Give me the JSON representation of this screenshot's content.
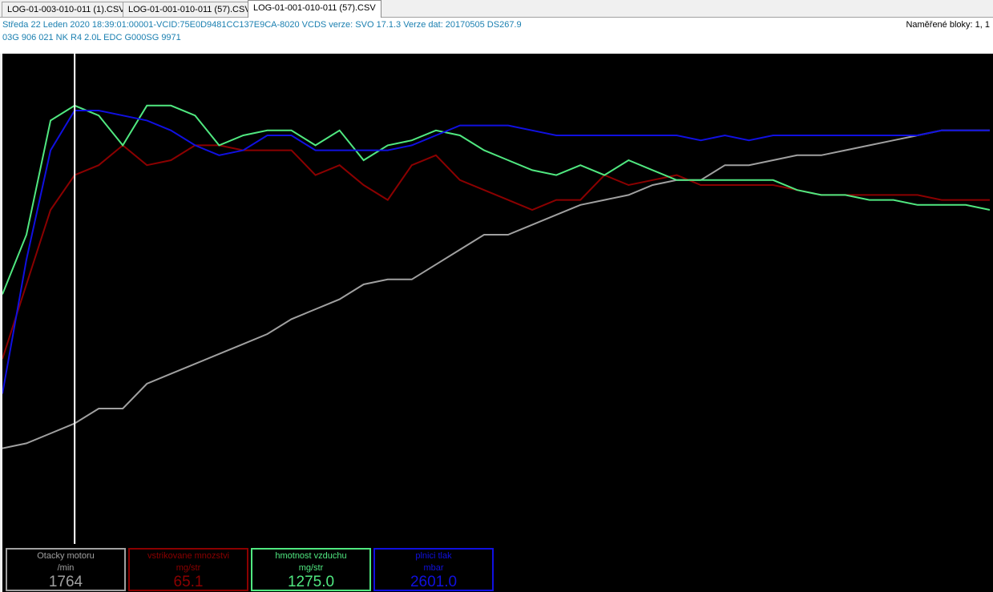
{
  "tabs": [
    {
      "label": "LOG-01-003-010-011 (1).CSV",
      "active": false
    },
    {
      "label": "LOG-01-001-010-011 (57).CSV",
      "active": false
    },
    {
      "label": "LOG-01-001-010-011 (57).CSV",
      "active": true
    }
  ],
  "header": {
    "line1": "Středa 22 Leden 2020 18:39:01:00001-VCID:75E0D9481CC137E9CA-8020 VCDS verze: SVO 17.1.3 Verze dat: 20170505 DS267.9",
    "line2": "03G 906 021 NK  R4 2.0L EDC G000SG  9971",
    "blocks": "Naměřené bloky: 1, 1"
  },
  "colors": {
    "background": "#000000",
    "gray": "#a0a0a0",
    "darkred": "#8b0000",
    "green": "#50e880",
    "blue": "#1010e0",
    "cursor": "#ffffff"
  },
  "gauges": [
    {
      "name": "Otacky motoru",
      "unit": "/min",
      "value": "1764",
      "color": "#a0a0a0"
    },
    {
      "name": "vstrikovane mnozstvi",
      "unit": "mg/str",
      "value": "65.1",
      "color": "#8b0000"
    },
    {
      "name": "hmotnost vzduchu",
      "unit": "mg/str",
      "value": "1275.0",
      "color": "#50e880"
    },
    {
      "name": "plnici tlak",
      "unit": "mbar",
      "value": "2601.0",
      "color": "#1010e0"
    }
  ],
  "chart_data": {
    "type": "line",
    "x": [
      0,
      1,
      2,
      3,
      4,
      5,
      6,
      7,
      8,
      9,
      10,
      11,
      12,
      13,
      14,
      15,
      16,
      17,
      18,
      19,
      20,
      21,
      22,
      23,
      24,
      25,
      26,
      27,
      28,
      29,
      30,
      31,
      32,
      33,
      34,
      35,
      36,
      37,
      38,
      39,
      40,
      41
    ],
    "cursor_x": 3,
    "ylim": [
      0,
      100
    ],
    "series": [
      {
        "color": "gray",
        "values": [
          27,
          28,
          30,
          32,
          35,
          35,
          40,
          42,
          44,
          46,
          48,
          50,
          53,
          55,
          57,
          60,
          61,
          61,
          64,
          67,
          70,
          70,
          72,
          74,
          76,
          77,
          78,
          80,
          81,
          81,
          84,
          84,
          85,
          86,
          86,
          87,
          88,
          89,
          90,
          91,
          91,
          91
        ]
      },
      {
        "color": "darkred",
        "values": [
          45,
          60,
          75,
          82,
          84,
          88,
          84,
          85,
          88,
          88,
          87,
          87,
          87,
          82,
          84,
          80,
          77,
          84,
          86,
          81,
          79,
          77,
          75,
          77,
          77,
          82,
          80,
          81,
          82,
          80,
          80,
          80,
          80,
          79,
          78,
          78,
          78,
          78,
          78,
          77,
          77,
          77
        ]
      },
      {
        "color": "green",
        "values": [
          58,
          70,
          93,
          96,
          94,
          88,
          96,
          96,
          94,
          88,
          90,
          91,
          91,
          88,
          91,
          85,
          88,
          89,
          91,
          90,
          87,
          85,
          83,
          82,
          84,
          82,
          85,
          83,
          81,
          81,
          81,
          81,
          81,
          79,
          78,
          78,
          77,
          77,
          76,
          76,
          76,
          75
        ]
      },
      {
        "color": "blue",
        "values": [
          38,
          65,
          87,
          95,
          95,
          94,
          93,
          91,
          88,
          86,
          87,
          90,
          90,
          87,
          87,
          87,
          87,
          88,
          90,
          92,
          92,
          92,
          91,
          90,
          90,
          90,
          90,
          90,
          90,
          89,
          90,
          89,
          90,
          90,
          90,
          90,
          90,
          90,
          90,
          91,
          91,
          91
        ]
      }
    ]
  }
}
